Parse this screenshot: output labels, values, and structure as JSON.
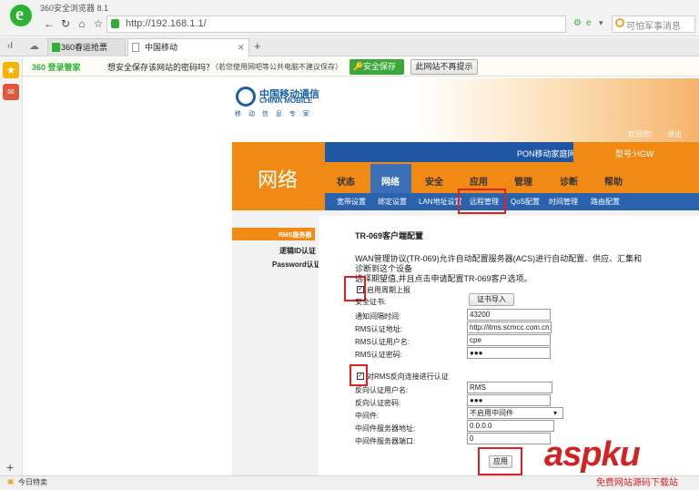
{
  "browser": {
    "app_name": "360安全浏览器 8.1",
    "logo_glyph": "e",
    "url": "http://192.168.1.1/",
    "search_placeholder": "可怕军事消息",
    "tabs": [
      {
        "label": "360春运抢票"
      },
      {
        "label": "中国移动"
      }
    ],
    "new_tab": "+"
  },
  "infobar": {
    "brand": "360 登录管家",
    "question": "想安全保存该网站的密码吗？",
    "hint": "（若您使用网吧等公共电脑不建议保存）",
    "save_label": "安全保存",
    "never_label": "此网站不再提示"
  },
  "statusbar": {
    "today": "今日特卖"
  },
  "router": {
    "brand_cn": "中国移动通信",
    "brand_en": "CHINA MOBILE",
    "slogan": "移 动 信 息 专 家",
    "welcome": "欢迎您!",
    "logout": "退出",
    "device": "PON移动家庭网关",
    "model": "型号:HGW",
    "section": "网络",
    "menu": [
      "状态",
      "网络",
      "安全",
      "应用",
      "管理",
      "诊断",
      "帮助"
    ],
    "submenu": [
      "宽带设置",
      "绑定设置",
      "LAN地址设置",
      "远程管理",
      "QoS配置",
      "时间管理",
      "路由配置"
    ],
    "left_items": [
      "RMS服务器",
      "逻辑ID认证",
      "Password认证"
    ]
  },
  "form": {
    "title": "TR-069客户端配置",
    "desc1": "WAN管理协议(TR-069)允许自动配置服务器(ACS)进行自动配置、供应、汇集和",
    "desc2": "诊断到这个设备",
    "desc3": "选择期望值,并且点击申请配置TR-069客户选项。",
    "periodic_label": "启用周期上报",
    "cert_label": "安全证书:",
    "cert_button": "证书导入",
    "inform_interval_label": "通知间隔时间:",
    "inform_interval_value": "43200",
    "rms_url_label": "RMS认证地址:",
    "rms_url_value": "http://itms.scmcc.com.cn:",
    "rms_user_label": "RMS认证用户名:",
    "rms_user_value": "cpe",
    "rms_pass_label": "RMS认证密码:",
    "rms_pass_value": "●●●",
    "reverse_label": "对RMS反向连接进行认证",
    "rev_user_label": "反向认证用户名:",
    "rev_user_value": "RMS",
    "rev_pass_label": "反向认证密码:",
    "rev_pass_value": "●●●",
    "middleware_label": "中间件:",
    "middleware_value": "不启用中间件",
    "mw_addr_label": "中间件服务器地址:",
    "mw_addr_value": "0.0.0.0",
    "mw_port_label": "中间件服务器端口:",
    "mw_port_value": "0",
    "apply_label": "应用"
  },
  "watermark": {
    "main": "aspku",
    "sub": "免费网站源码下载站"
  },
  "colors": {
    "orange": "#f08a14",
    "blue": "#1f57a4",
    "highlight": "#e02020",
    "green": "#2db135"
  }
}
